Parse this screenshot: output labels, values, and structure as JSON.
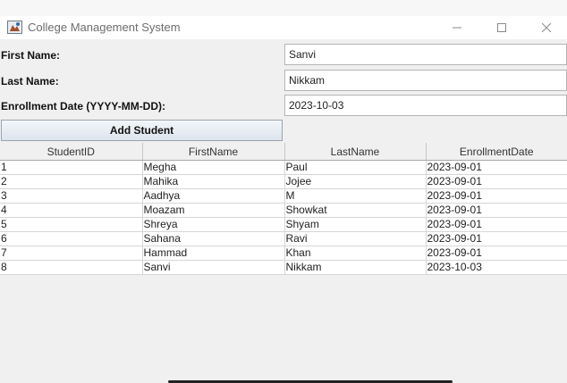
{
  "window": {
    "title": "College Management System"
  },
  "form": {
    "first_name_label": "First Name:",
    "first_name_value": "Sanvi",
    "last_name_label": "Last Name:",
    "last_name_value": "Nikkam",
    "enrollment_label": "Enrollment Date (YYYY-MM-DD):",
    "enrollment_value": "2023-10-03",
    "add_button_label": "Add Student"
  },
  "table": {
    "headers": [
      "StudentID",
      "FirstName",
      "LastName",
      "EnrollmentDate"
    ],
    "rows": [
      [
        "1",
        "Megha",
        "Paul",
        "2023-09-01"
      ],
      [
        "2",
        "Mahika",
        "Jojee",
        "2023-09-01"
      ],
      [
        "3",
        "Aadhya",
        "M",
        "2023-09-01"
      ],
      [
        "4",
        "Moazam",
        "Showkat",
        "2023-09-01"
      ],
      [
        "5",
        "Shreya",
        "Shyam",
        "2023-09-01"
      ],
      [
        "6",
        "Sahana",
        "Ravi",
        "2023-09-01"
      ],
      [
        "7",
        "Hammad",
        "Khan",
        "2023-09-01"
      ],
      [
        "8",
        "Sanvi",
        "Nikkam",
        "2023-10-03"
      ]
    ]
  }
}
